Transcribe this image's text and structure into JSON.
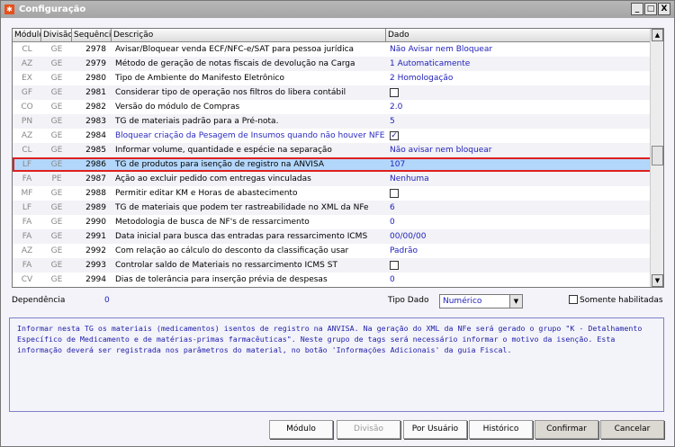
{
  "window": {
    "title": "Configuração",
    "minimize": "_",
    "maximize": "□",
    "close": "X"
  },
  "grid": {
    "headers": [
      "Módulo",
      "Divisão",
      "Sequência",
      "Descrição",
      "Dado"
    ],
    "rows": [
      {
        "modulo": "CL",
        "divisao": "GE",
        "seq": "2978",
        "descricao": "Avisar/Bloquear venda ECF/NFC-e/SAT para pessoa jurídica",
        "dado": "Não Avisar nem Bloquear"
      },
      {
        "modulo": "AZ",
        "divisao": "GE",
        "seq": "2979",
        "descricao": "Método de geração de notas fiscais de devolução na Carga",
        "dado": "1 Automaticamente"
      },
      {
        "modulo": "EX",
        "divisao": "GE",
        "seq": "2980",
        "descricao": "Tipo de Ambiente do Manifesto Eletrônico",
        "dado": "2 Homologação"
      },
      {
        "modulo": "GF",
        "divisao": "GE",
        "seq": "2981",
        "descricao": "Considerar tipo de operação nos filtros do libera contábil",
        "dado": "",
        "checkbox": false
      },
      {
        "modulo": "CO",
        "divisao": "GE",
        "seq": "2982",
        "descricao": "Versão do módulo de Compras",
        "dado": "2.0"
      },
      {
        "modulo": "PN",
        "divisao": "GE",
        "seq": "2983",
        "descricao": "TG de materiais padrão para a Pré-nota.",
        "dado": "5"
      },
      {
        "modulo": "AZ",
        "divisao": "GE",
        "seq": "2984",
        "descricao": "Bloquear criação da Pesagem de Insumos quando não houver NFE",
        "dado": "",
        "checkbox": true
      },
      {
        "modulo": "CL",
        "divisao": "GE",
        "seq": "2985",
        "descricao": "Informar volume, quantidade e espécie na separação",
        "dado": "Não avisar nem bloquear"
      },
      {
        "modulo": "LF",
        "divisao": "GE",
        "seq": "2986",
        "descricao": "TG de produtos para isenção de registro na ANVISA",
        "dado": "107",
        "selected": true
      },
      {
        "modulo": "FA",
        "divisao": "PE",
        "seq": "2987",
        "descricao": "Ação ao excluir pedido com entregas vinculadas",
        "dado": "Nenhuma"
      },
      {
        "modulo": "MF",
        "divisao": "GE",
        "seq": "2988",
        "descricao": "Permitir editar KM e Horas de abastecimento",
        "dado": "",
        "checkbox": false
      },
      {
        "modulo": "LF",
        "divisao": "GE",
        "seq": "2989",
        "descricao": "TG de materiais que podem ter rastreabilidade no XML da NFe",
        "dado": "6"
      },
      {
        "modulo": "FA",
        "divisao": "GE",
        "seq": "2990",
        "descricao": "Metodologia de busca de NF's de ressarcimento",
        "dado": "0"
      },
      {
        "modulo": "FA",
        "divisao": "GE",
        "seq": "2991",
        "descricao": "Data inicial para busca das entradas para ressarcimento ICMS",
        "dado": "00/00/00"
      },
      {
        "modulo": "AZ",
        "divisao": "GE",
        "seq": "2992",
        "descricao": "Com relação ao cálculo do desconto da classificação usar",
        "dado": "Padrão"
      },
      {
        "modulo": "FA",
        "divisao": "GE",
        "seq": "2993",
        "descricao": "Controlar saldo de Materiais no ressarcimento ICMS ST",
        "dado": "",
        "checkbox": false
      },
      {
        "modulo": "CV",
        "divisao": "GE",
        "seq": "2994",
        "descricao": "Dias de tolerância para inserção prévia de despesas",
        "dado": "0"
      }
    ]
  },
  "footer": {
    "dependencia_label": "Dependência",
    "dependencia_value": "0",
    "tipo_dado_label": "Tipo Dado",
    "tipo_dado_value": "Numérico",
    "somente_label": "Somente habilitadas"
  },
  "description": "Informar nesta TG os materiais (medicamentos) isentos de registro na ANVISA. Na geração do XML da NFe será gerado o grupo \"K - Detalhamento Específico de Medicamento e de matérias-primas farmacêuticas\". Neste grupo de tags será necessário informar o motivo da isenção. Esta informação deverá ser registrada nos parâmetros do material, no botão 'Informações Adicionais' da guia Fiscal.",
  "buttons": {
    "modulo": "Módulo",
    "divisao": "Divisão",
    "por_usuario": "Por Usuário",
    "historico": "Histórico",
    "confirmar": "Confirmar",
    "cancelar": "Cancelar"
  }
}
